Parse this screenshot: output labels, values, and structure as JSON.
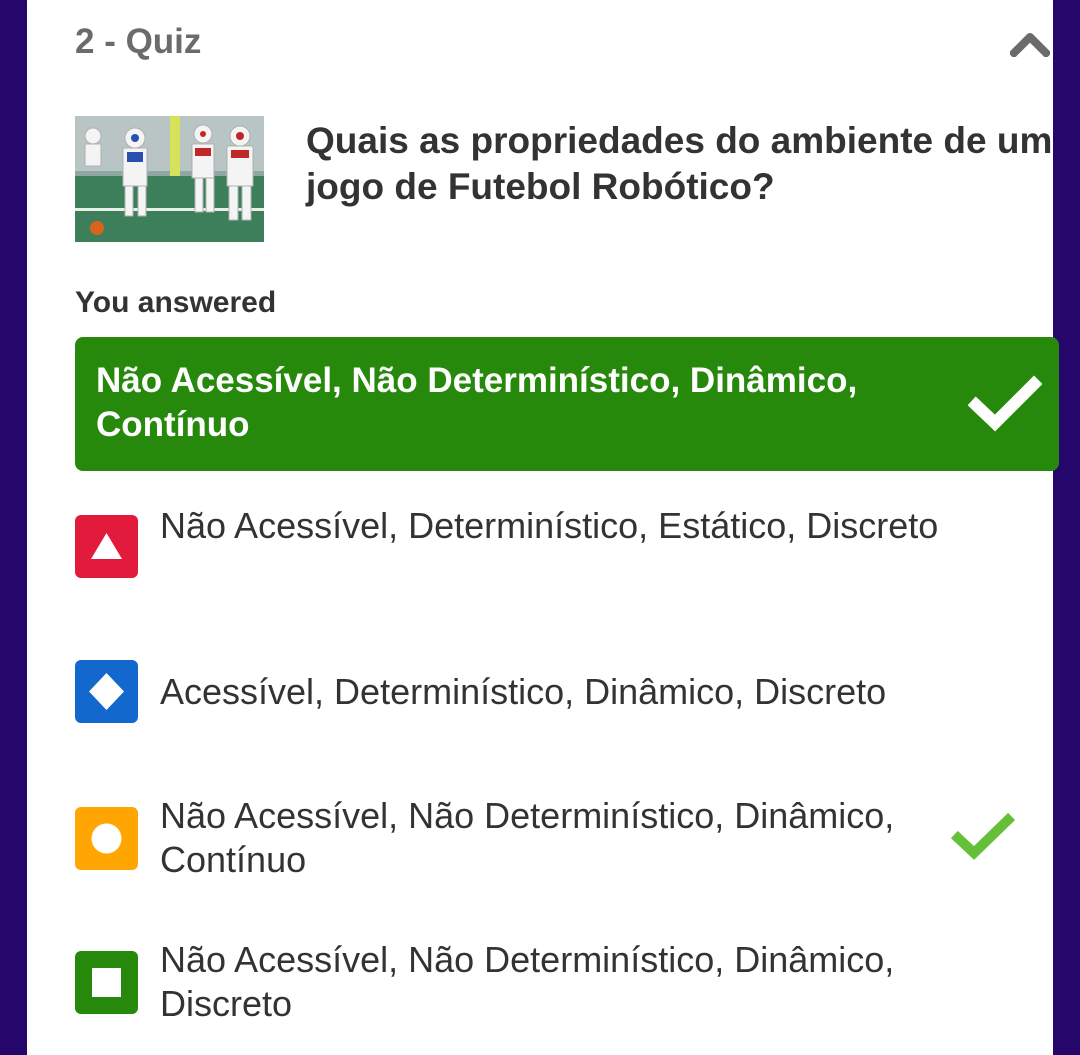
{
  "quiz": {
    "title": "2 - Quiz",
    "collapse_icon": "chevron-up-icon",
    "question": "Quais as propriedades do ambiente de um jogo de Futebol Robótico?"
  },
  "answered": {
    "label": "You answered",
    "text": "Não Acessível, Não Determinístico, Dinâmico, Contínuo",
    "correct": true,
    "color": "#26890c",
    "icon": "checkmark-icon"
  },
  "options": [
    {
      "shape": "triangle",
      "color": "#e21b3c",
      "text": "Não Acessível, Determinístico, Estático, Discreto",
      "correct": false
    },
    {
      "shape": "diamond",
      "color": "#1368ce",
      "text": "Acessível, Determinístico, Dinâmico, Discreto",
      "correct": false
    },
    {
      "shape": "circle",
      "color": "#ffa602",
      "text": "Não Acessível, Não Determinístico, Dinâmico, Contínuo",
      "correct": true,
      "check_color": "#66bf39"
    },
    {
      "shape": "square",
      "color": "#26890c",
      "text": "Não Acessível, Não Determinístico, Dinâmico, Discreto",
      "correct": false
    }
  ]
}
